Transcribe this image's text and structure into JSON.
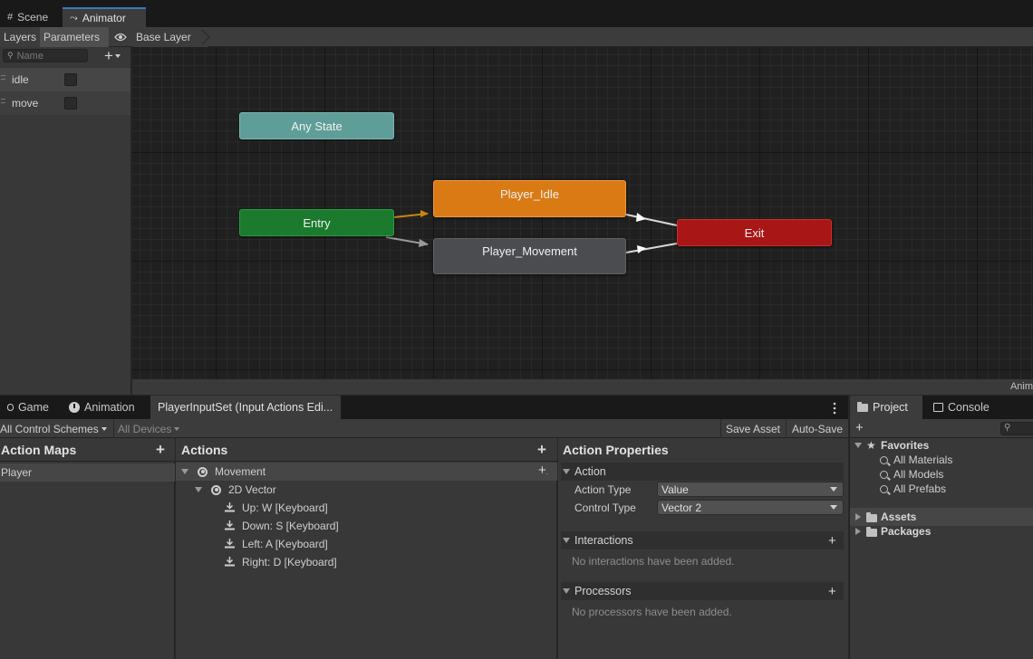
{
  "window_tabs": [
    {
      "label": "Scene",
      "icon": "grid-icon"
    },
    {
      "label": "Animator",
      "icon": "animator-icon"
    }
  ],
  "animator": {
    "layers_tab": "Layers",
    "parameters_tab": "Parameters",
    "breadcrumb": "Base Layer",
    "search_placeholder": "Name",
    "add_label": "+",
    "parameters": [
      {
        "name": "idle",
        "value": false
      },
      {
        "name": "move",
        "value": false
      }
    ],
    "states": {
      "any_state": "Any State",
      "entry": "Entry",
      "player_idle": "Player_Idle",
      "player_movement": "Player_Movement",
      "exit": "Exit"
    },
    "status_text": "Anim",
    "colors": {
      "any_state": "#5f9e98",
      "entry": "#1b7a2d",
      "default_state": "#d97a14",
      "state": "#4a4c50",
      "exit": "#a81616",
      "default_transition": "#c9860f",
      "transition": "#d8d8d8"
    }
  },
  "bottom_tabs": [
    {
      "label": "Game",
      "icon": "gamepad-icon"
    },
    {
      "label": "Animation",
      "icon": "clock-icon"
    },
    {
      "label": "PlayerInputSet (Input Actions Edi...",
      "icon": ""
    }
  ],
  "input_actions": {
    "control_schemes": "All Control Schemes",
    "devices": "All Devices",
    "save_asset": "Save Asset",
    "auto_save": "Auto-Save",
    "action_maps_title": "Action Maps",
    "action_maps": [
      "Player"
    ],
    "actions_title": "Actions",
    "actions": [
      {
        "label": "Movement",
        "level": 0,
        "type": "action"
      },
      {
        "label": "2D Vector",
        "level": 1,
        "type": "composite"
      },
      {
        "label": "Up: W [Keyboard]",
        "level": 2,
        "type": "binding"
      },
      {
        "label": "Down: S [Keyboard]",
        "level": 2,
        "type": "binding"
      },
      {
        "label": "Left: A [Keyboard]",
        "level": 2,
        "type": "binding"
      },
      {
        "label": "Right: D [Keyboard]",
        "level": 2,
        "type": "binding"
      }
    ],
    "properties_title": "Action Properties",
    "action_section": "Action",
    "action_type_label": "Action Type",
    "action_type_value": "Value",
    "control_type_label": "Control Type",
    "control_type_value": "Vector 2",
    "interactions_section": "Interactions",
    "interactions_empty": "No interactions have been added.",
    "processors_section": "Processors",
    "processors_empty": "No processors have been added."
  },
  "project": {
    "tabs": [
      {
        "label": "Project",
        "icon": "folder-icon"
      },
      {
        "label": "Console",
        "icon": "console-icon"
      }
    ],
    "favorites": "Favorites",
    "favorite_items": [
      "All Materials",
      "All Models",
      "All Prefabs"
    ],
    "assets": "Assets",
    "packages": "Packages"
  }
}
